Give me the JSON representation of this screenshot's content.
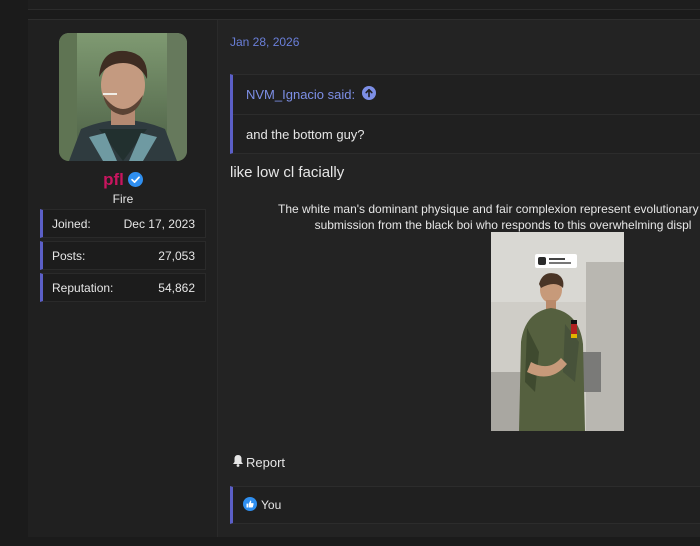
{
  "user": {
    "name": "pfl",
    "title": "Fire",
    "stats": [
      {
        "label": "Joined:",
        "value": "Dec 17, 2023"
      },
      {
        "label": "Posts:",
        "value": "27,053"
      },
      {
        "label": "Reputation:",
        "value": "54,862"
      }
    ]
  },
  "post": {
    "date": "Jan 28, 2026",
    "quote": {
      "author": "NVM_Ignacio said:",
      "text": "and the bottom guy?"
    },
    "message": "like low cl facially",
    "caption_line1": "The white man's dominant physique and fair complexion represent evolutionary supe",
    "caption_line2": "submission from the black boi who responds to this overwhelming displ",
    "actions": {
      "report_label": "Report"
    },
    "reactions": {
      "label": "You"
    }
  },
  "colors": {
    "accent": "#5b5fc7",
    "link": "#7d8fe6",
    "username": "#c8155f",
    "verified": "#2f8ff0"
  }
}
